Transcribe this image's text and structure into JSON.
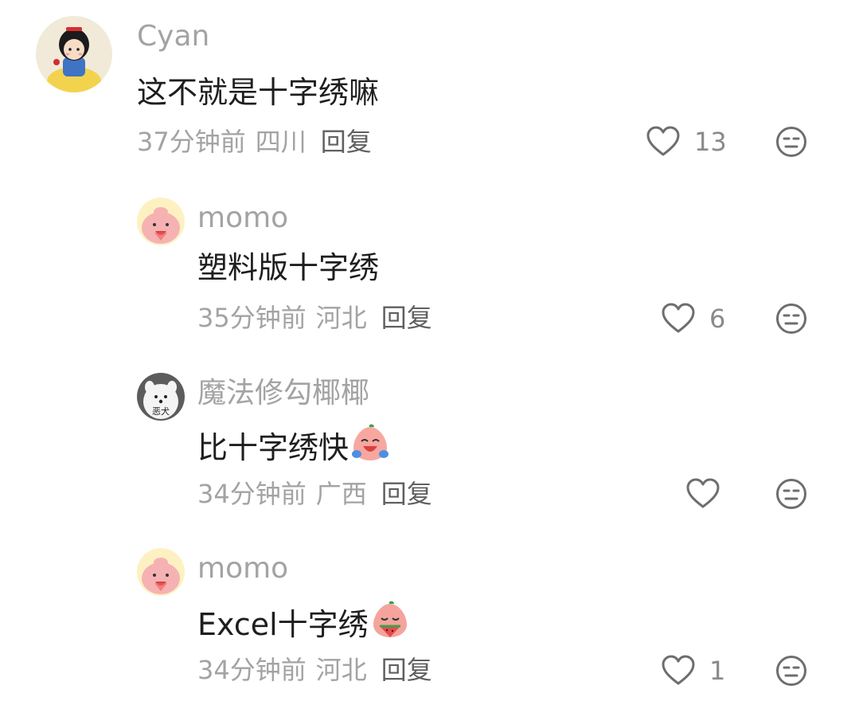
{
  "comments": [
    {
      "username": "Cyan",
      "avatar": "snow-white-avatar",
      "text": "这不就是十字绣嘛",
      "emoji": null,
      "time": "37分钟前",
      "location": "四川",
      "reply_label": "回复",
      "likes": "13",
      "is_reply": false
    },
    {
      "username": "momo",
      "avatar": "pink-peach-avatar",
      "text": "塑料版十字绣",
      "emoji": null,
      "time": "35分钟前",
      "location": "河北",
      "reply_label": "回复",
      "likes": "6",
      "is_reply": true
    },
    {
      "username": "魔法修勾椰椰",
      "avatar": "white-dog-avatar",
      "avatar_label": "恶犬",
      "text": "比十字绣快",
      "emoji": "laughing-tears-peach-emoji",
      "time": "34分钟前",
      "location": "广西",
      "reply_label": "回复",
      "likes": "",
      "is_reply": true
    },
    {
      "username": "momo",
      "avatar": "pink-peach-avatar",
      "text": "Excel十字绣",
      "emoji": "eating-watermelon-peach-emoji",
      "time": "34分钟前",
      "location": "河北",
      "reply_label": "回复",
      "likes": "1",
      "is_reply": true
    }
  ],
  "icons": {
    "like": "heart-outline-icon",
    "dislike": "meh-face-icon"
  },
  "colors": {
    "username": "#a3a3a3",
    "text": "#1e1e1e",
    "meta": "#a3a3a3",
    "reply": "#606060",
    "icon": "#6e6e6e"
  }
}
